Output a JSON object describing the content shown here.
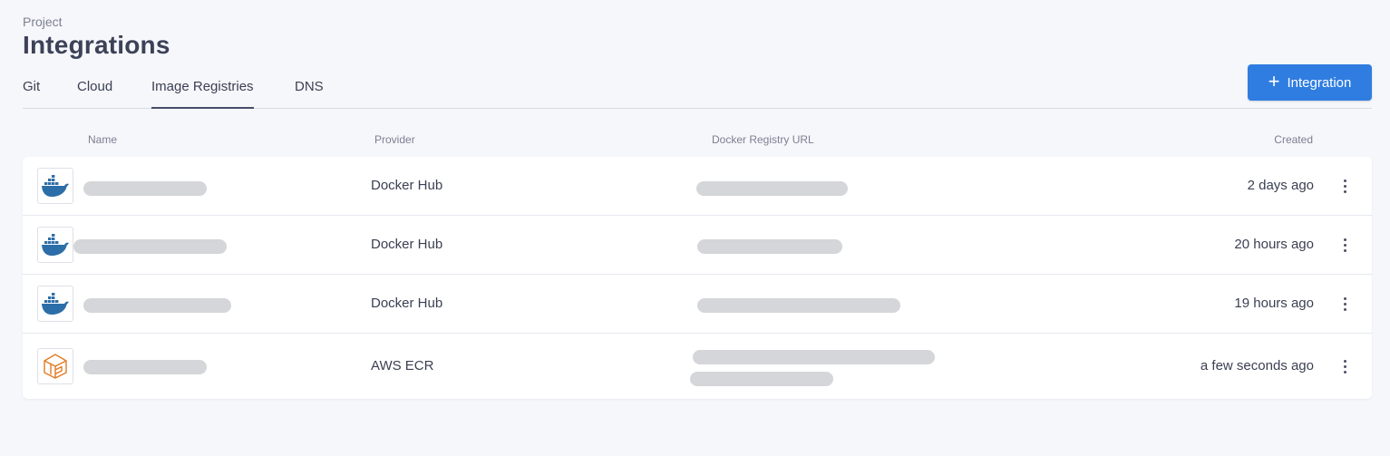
{
  "header": {
    "breadcrumb": "Project",
    "title": "Integrations"
  },
  "tabs": [
    {
      "label": "Git"
    },
    {
      "label": "Cloud"
    },
    {
      "label": "Image Registries",
      "active": true
    },
    {
      "label": "DNS"
    }
  ],
  "actions": {
    "add_label": "Integration",
    "add_icon": "plus-icon"
  },
  "table": {
    "columns": [
      "Name",
      "Provider",
      "Docker Registry URL",
      "Created"
    ],
    "rows": [
      {
        "icon": "docker-icon",
        "name": "",
        "provider": "Docker Hub",
        "url": "",
        "created": "2 days ago"
      },
      {
        "icon": "docker-icon",
        "name": "",
        "provider": "Docker Hub",
        "url": "",
        "created": "20 hours ago"
      },
      {
        "icon": "docker-icon",
        "name": "",
        "provider": "Docker Hub",
        "url": "",
        "created": "19 hours ago"
      },
      {
        "icon": "aws-ecr-icon",
        "name": "",
        "provider": "AWS ECR",
        "url": "",
        "created": "a few seconds ago"
      }
    ]
  },
  "colors": {
    "accent": "#2f7de1",
    "docker_blue": "#2c6ea8",
    "ecr_orange": "#e07b24"
  }
}
